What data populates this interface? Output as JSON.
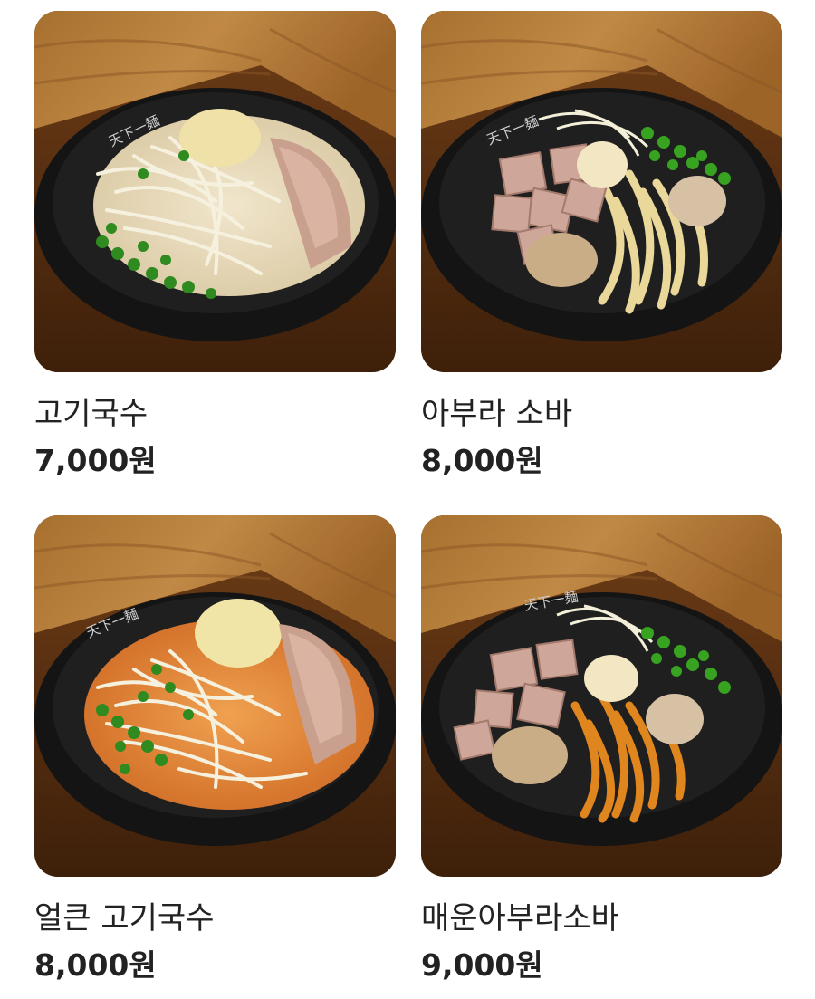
{
  "menu": {
    "items": [
      {
        "name": "고기국수",
        "price": "7,000원",
        "image_icon": "pork-noodle-soup-photo"
      },
      {
        "name": "아부라 소바",
        "price": "8,000원",
        "image_icon": "abura-soba-photo"
      },
      {
        "name": "얼큰 고기국수",
        "price": "8,000원",
        "image_icon": "spicy-pork-noodle-soup-photo"
      },
      {
        "name": "매운아부라소바",
        "price": "9,000원",
        "image_icon": "spicy-abura-soba-photo"
      }
    ],
    "bowl_logo": "天下一麺"
  },
  "colors": {
    "text": "#222222",
    "wood": "#8a5427",
    "bowl": "#1b1b1b"
  }
}
